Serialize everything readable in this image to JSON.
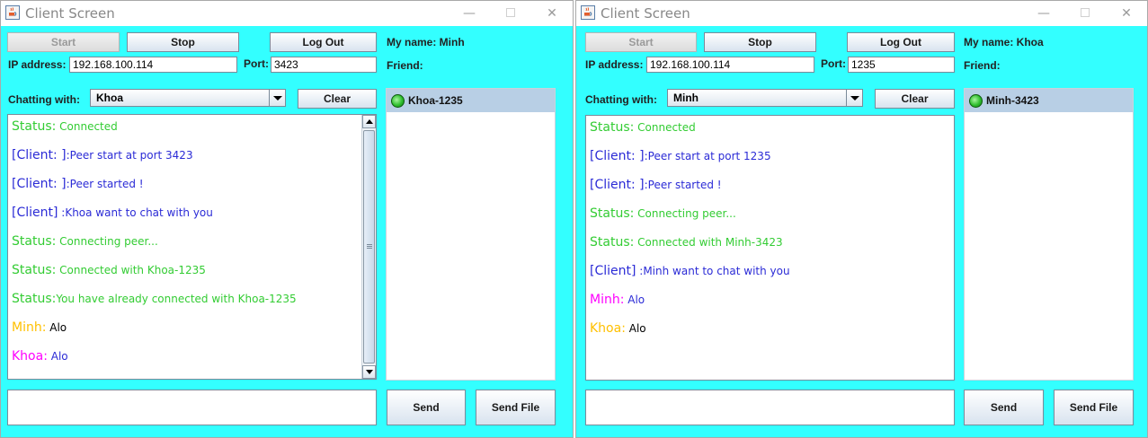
{
  "colors": {
    "window_bg": "#33ffff",
    "status": "#33cc33",
    "client": "#2b2bd6",
    "minh_name": "#ff00ff",
    "khoa_name": "#ffc000"
  },
  "left": {
    "title": "Client Screen",
    "start_label": "Start",
    "stop_label": "Stop",
    "logout_label": "Log Out",
    "my_name": "My name: Minh",
    "friend_label": "Friend:",
    "ip_label": "IP address:",
    "ip_value": "192.168.100.114",
    "port_label": "Port:",
    "port_value": "3423",
    "chatting_label": "Chatting with:",
    "chatting_value": "Khoa",
    "clear_label": "Clear",
    "friend_item": "Khoa-1235",
    "send_label": "Send",
    "send_file_label": "Send File",
    "messages": [
      {
        "prefix": "Status:",
        "text": " Connected",
        "prefix_color": "#33cc33",
        "text_color": "#33cc33"
      },
      {
        "prefix": "[Client: ]",
        "text": ":Peer start at port 3423",
        "prefix_color": "#2b2bd6",
        "text_color": "#2b2bd6"
      },
      {
        "prefix": "[Client: ]",
        "text": ":Peer started !",
        "prefix_color": "#2b2bd6",
        "text_color": "#2b2bd6"
      },
      {
        "prefix": "[Client]",
        "text": " :Khoa want to chat with you",
        "prefix_color": "#2b2bd6",
        "text_color": "#2b2bd6"
      },
      {
        "prefix": "Status:",
        "text": " Connecting peer...",
        "prefix_color": "#33cc33",
        "text_color": "#33cc33"
      },
      {
        "prefix": "Status:",
        "text": " Connected with Khoa-1235",
        "prefix_color": "#33cc33",
        "text_color": "#33cc33"
      },
      {
        "prefix": "Status:",
        "text": "You have already connected with Khoa-1235",
        "prefix_color": "#33cc33",
        "text_color": "#33cc33"
      },
      {
        "prefix": "Minh:",
        "text": " Alo",
        "prefix_color": "#ffc000",
        "text_color": "#000000"
      },
      {
        "prefix": "Khoa:",
        "text": " Alo",
        "prefix_color": "#ff00ff",
        "text_color": "#2b2bd6"
      }
    ]
  },
  "right": {
    "title": "Client Screen",
    "start_label": "Start",
    "stop_label": "Stop",
    "logout_label": "Log Out",
    "my_name": "My name: Khoa",
    "friend_label": "Friend:",
    "ip_label": "IP address:",
    "ip_value": "192.168.100.114",
    "port_label": "Port:",
    "port_value": "1235",
    "chatting_label": "Chatting with:",
    "chatting_value": "Minh",
    "clear_label": "Clear",
    "friend_item": "Minh-3423",
    "send_label": "Send",
    "send_file_label": "Send File",
    "messages": [
      {
        "prefix": "Status:",
        "text": " Connected",
        "prefix_color": "#33cc33",
        "text_color": "#33cc33"
      },
      {
        "prefix": "[Client: ]",
        "text": ":Peer start at port 1235",
        "prefix_color": "#2b2bd6",
        "text_color": "#2b2bd6"
      },
      {
        "prefix": "[Client: ]",
        "text": ":Peer started !",
        "prefix_color": "#2b2bd6",
        "text_color": "#2b2bd6"
      },
      {
        "prefix": "Status:",
        "text": " Connecting peer...",
        "prefix_color": "#33cc33",
        "text_color": "#33cc33"
      },
      {
        "prefix": "Status:",
        "text": " Connected with Minh-3423",
        "prefix_color": "#33cc33",
        "text_color": "#33cc33"
      },
      {
        "prefix": "[Client]",
        "text": " :Minh want to chat with you",
        "prefix_color": "#2b2bd6",
        "text_color": "#2b2bd6"
      },
      {
        "prefix": "Minh:",
        "text": " Alo",
        "prefix_color": "#ff00ff",
        "text_color": "#2b2bd6"
      },
      {
        "prefix": "Khoa:",
        "text": " Alo",
        "prefix_color": "#ffc000",
        "text_color": "#000000"
      }
    ]
  }
}
